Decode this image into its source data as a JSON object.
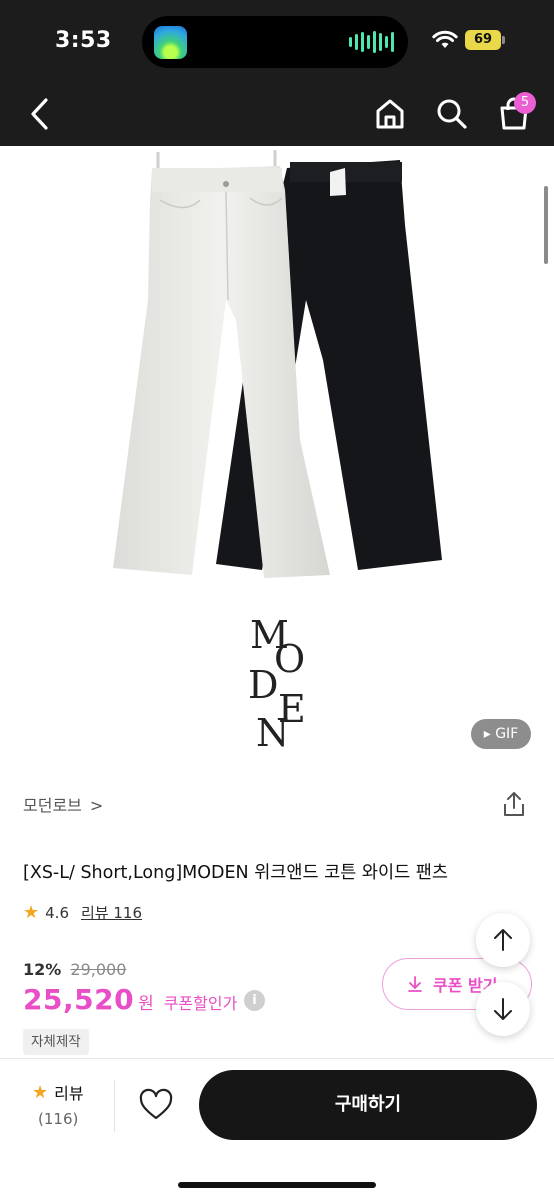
{
  "status_bar": {
    "time": "3:53",
    "battery": "69"
  },
  "nav": {
    "cart_count": "5"
  },
  "product": {
    "image_badge": "▸ GIF",
    "logo_letters": [
      "M",
      "O",
      "D",
      "E",
      "N"
    ],
    "brand": "모던로브",
    "title": "[XS-L/ Short,Long]MODEN 위크앤드 코튼 와이드 팬츠",
    "rating": "4.6",
    "review_label": "리뷰 116",
    "discount": "12%",
    "original_price": "29,000",
    "price": "25,520",
    "currency": "원",
    "coupon_price_label": "쿠폰할인가",
    "tag": "자체제작",
    "coupon_button": "쿠폰 받기"
  },
  "bottom_bar": {
    "review_label": "리뷰",
    "review_count": "(116)",
    "buy_label": "구매하기"
  },
  "colors": {
    "accent_pink": "#e94ec6",
    "dark": "#161616",
    "star": "#f3a623"
  }
}
